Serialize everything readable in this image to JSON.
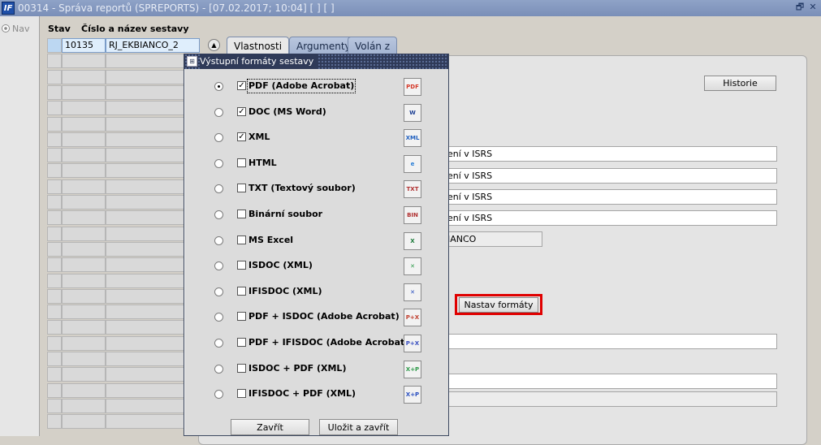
{
  "window": {
    "app_icon_text": "IF",
    "title": "00314 - Správa reportů (SPREPORTS) - [07.02.2017; 10:04]  [ ]  [ ]",
    "restore_glyph": "🗗",
    "close_glyph": "✕"
  },
  "nav": {
    "label": "Nav"
  },
  "grid": {
    "headers": {
      "status": "Stav",
      "number_name": "Číslo a název sestavy"
    },
    "active_row": {
      "number": "10135",
      "name": "RJ_EKBIANCO_2"
    }
  },
  "tabs": [
    {
      "label": "Vlastnosti"
    },
    {
      "label": "Argumenty"
    },
    {
      "label": "Volán z"
    }
  ],
  "panel": {
    "historie_button": "Historie",
    "fields": [
      "ení v ISRS",
      "ení v ISRS",
      "ení v ISRS",
      "ení v ISRS"
    ],
    "readonly_field": "IANCO",
    "nastav_formaty_button": "Nastav formáty"
  },
  "dialog": {
    "icon_text": "⊞",
    "title": "Výstupní formáty sestavy",
    "formats": [
      {
        "label": "PDF (Adobe Acrobat)",
        "checked": true,
        "selected": true,
        "icon": "pdf-icon",
        "icon_text": "PDF",
        "icon_color": "#d43a2a"
      },
      {
        "label": "DOC (MS Word)",
        "checked": true,
        "selected": false,
        "icon": "word-icon",
        "icon_text": "W",
        "icon_color": "#1c3f94"
      },
      {
        "label": "XML",
        "checked": true,
        "selected": false,
        "icon": "xml-icon",
        "icon_text": "XML",
        "icon_color": "#1f5fbf"
      },
      {
        "label": "HTML",
        "checked": false,
        "selected": false,
        "icon": "ie-icon",
        "icon_text": "e",
        "icon_color": "#2a7fd6"
      },
      {
        "label": "TXT (Textový soubor)",
        "checked": false,
        "selected": false,
        "icon": "txt-icon",
        "icon_text": "TXT",
        "icon_color": "#b03030"
      },
      {
        "label": "Binární soubor",
        "checked": false,
        "selected": false,
        "icon": "bin-icon",
        "icon_text": "BIN",
        "icon_color": "#b03030"
      },
      {
        "label": "MS Excel",
        "checked": false,
        "selected": false,
        "icon": "excel-icon",
        "icon_text": "X",
        "icon_color": "#1d7a3a"
      },
      {
        "label": "ISDOC (XML)",
        "checked": false,
        "selected": false,
        "icon": "isdoc-icon",
        "icon_text": "✕",
        "icon_color": "#2f9a4a"
      },
      {
        "label": "IFISDOC (XML)",
        "checked": false,
        "selected": false,
        "icon": "ifisdoc-icon",
        "icon_text": "✕",
        "icon_color": "#2a4fc0"
      },
      {
        "label": "PDF + ISDOC (Adobe Acrobat)",
        "checked": false,
        "selected": false,
        "icon": "pdf-isdoc-icon",
        "icon_text": "P+X",
        "icon_color": "#c04030"
      },
      {
        "label": "PDF + IFISDOC (Adobe Acrobat)",
        "checked": false,
        "selected": false,
        "icon": "pdf-ifisdoc-icon",
        "icon_text": "P+X",
        "icon_color": "#3a50c0"
      },
      {
        "label": "ISDOC + PDF (XML)",
        "checked": false,
        "selected": false,
        "icon": "isdoc-pdf-icon",
        "icon_text": "X+P",
        "icon_color": "#2f9a4a"
      },
      {
        "label": "IFISDOC + PDF (XML)",
        "checked": false,
        "selected": false,
        "icon": "ifisdoc-pdf-icon",
        "icon_text": "X+P",
        "icon_color": "#2a4fc0"
      }
    ],
    "close_button": "Zavřít",
    "save_close_button": "Uložit a zavřít"
  }
}
